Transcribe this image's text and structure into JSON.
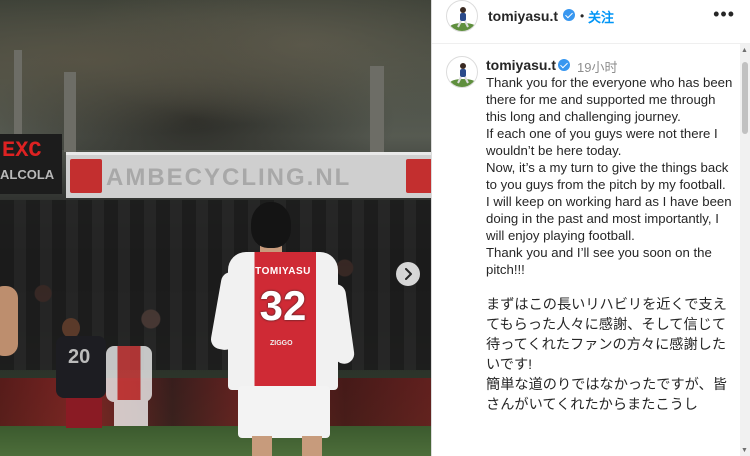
{
  "post_image": {
    "banner_text": "AMBECYCLING.NL",
    "scoreboard_text": "EXC",
    "scoreboard_sub": "ALCOLA",
    "player_name": "TOMIYASU",
    "player_number": "32",
    "player_sponsor": "ZIGGO",
    "other_player_number": "20",
    "next_button_icon": "chevron-right-icon"
  },
  "header": {
    "username": "tomiyasu.t",
    "dot": "•",
    "follow_label": "关注",
    "more_icon": "•••"
  },
  "comment": {
    "username": "tomiyasu.t",
    "time": "19小时",
    "caption_en": [
      "Thank you for the everyone who has been there for me and supported me through this long and challenging journey.",
      "If each one of you guys were not there I wouldn’t be here today.",
      "Now, it’s a my turn to give the things back to you guys from the pitch by my football.",
      "I will keep on working hard as I have been doing in the past and most importantly, I will enjoy playing football.",
      "Thank you and I’ll see you soon on the pitch!!!"
    ],
    "caption_jp": [
      "まずはこの長いリハビリを近くで支えてもらった人々に感謝、そして信じて待ってくれたファンの方々に感謝したいです!",
      "簡単な道のりではなかったですが、皆さんがいてくれたからまたこうし"
    ]
  },
  "colors": {
    "accent": "#0095f6",
    "verified": "#3897f0",
    "muted": "#8e8e8e"
  }
}
